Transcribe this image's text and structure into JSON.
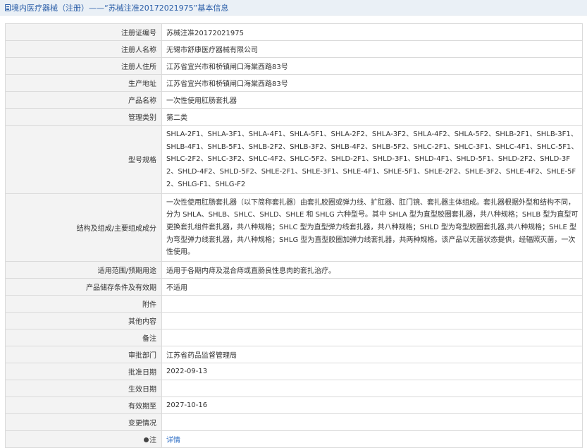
{
  "header": {
    "title": "境内医疗器械（注册）——“苏械注准20172021975”基本信息"
  },
  "rows": [
    {
      "label": "注册证编号",
      "value": "苏械注准20172021975"
    },
    {
      "label": "注册人名称",
      "value": "无锡市舒康医疗器械有限公司"
    },
    {
      "label": "注册人住所",
      "value": "江苏省宜兴市和桥镇闸口海棠西路83号"
    },
    {
      "label": "生产地址",
      "value": "江苏省宜兴市和桥镇闸口海棠西路83号"
    },
    {
      "label": "产品名称",
      "value": "一次性使用肛肠套扎器"
    },
    {
      "label": "管理类别",
      "value": "第二类"
    },
    {
      "label": "型号规格",
      "value": "SHLA-2F1、SHLA-3F1、SHLA-4F1、SHLA-5F1、SHLA-2F2、SHLA-3F2、SHLA-4F2、SHLA-5F2、SHLB-2F1、SHLB-3F1、SHLB-4F1、SHLB-5F1、SHLB-2F2、SHLB-3F2、SHLB-4F2、SHLB-5F2、SHLC-2F1、SHLC-3F1、SHLC-4F1、SHLC-5F1、SHLC-2F2、SHLC-3F2、SHLC-4F2、SHLC-5F2、SHLD-2F1、SHLD-3F1、SHLD-4F1、SHLD-5F1、SHLD-2F2、SHLD-3F2、SHLD-4F2、SHLD-5F2、SHLE-2F1、SHLE-3F1、SHLE-4F1、SHLE-5F1、SHLE-2F2、SHLE-3F2、SHLE-4F2、SHLE-5F2、SHLG-F1、SHLG-F2"
    },
    {
      "label": "结构及组成/主要组成成分",
      "value": "一次性使用肛肠套扎器（以下简称套扎器）由套扎胶圈或弹力线、扩肛器、肛门镜、套扎器主体组成。套扎器根据外型和结构不同，分为 SHLA、SHLB、SHLC、SHLD、SHLE 和 SHLG 六种型号。其中 SHLA 型为直型胶圈套扎器，共八种规格；SHLB 型为直型可更换套扎组件套扎器，共八种规格；SHLC 型为直型弹力线套扎器，共八种规格；SHLD 型为弯型胶圈套扎器,共八种规格；SHLE 型为弯型弹力线套扎器，共八种规格；SHLG 型为直型胶圈加弹力线套扎器，共两种规格。该产品以无菌状态提供，经辐照灭菌，一次性使用。"
    },
    {
      "label": "适用范围/预期用途",
      "value": "适用于各期内痔及混合痔或直肠良性息肉的套扎治疗。"
    },
    {
      "label": "产品储存条件及有效期",
      "value": "不适用"
    },
    {
      "label": "附件",
      "value": ""
    },
    {
      "label": "其他内容",
      "value": ""
    },
    {
      "label": "备注",
      "value": ""
    },
    {
      "label": "审批部门",
      "value": "江苏省药品监督管理局"
    },
    {
      "label": "批准日期",
      "value": "2022-09-13"
    },
    {
      "label": "生效日期",
      "value": ""
    },
    {
      "label": "有效期至",
      "value": "2027-10-16"
    },
    {
      "label": "变更情况",
      "value": ""
    },
    {
      "label": "注",
      "value": "详情"
    }
  ]
}
